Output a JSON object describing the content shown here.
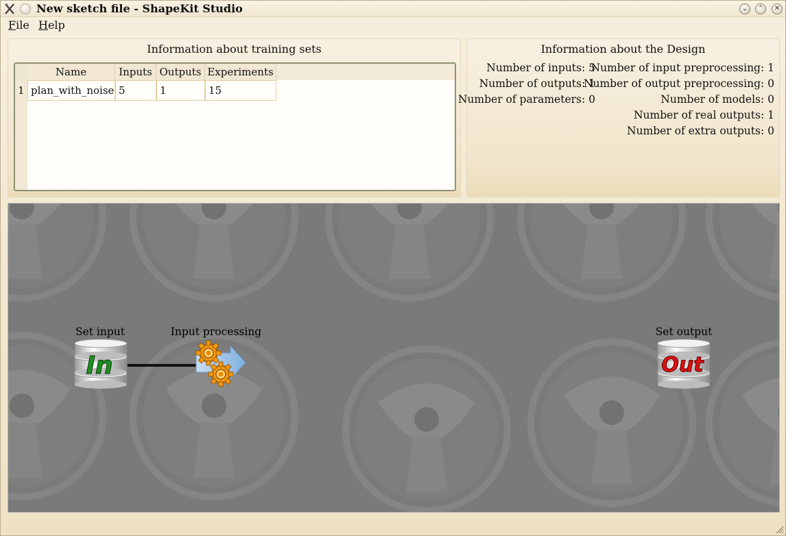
{
  "window": {
    "title": "New sketch file - ShapeKit Studio",
    "controls": {
      "minimize": "⌄",
      "maximize": "⌃",
      "close": "✕"
    }
  },
  "menu": {
    "file": {
      "accel": "F",
      "rest": "ile"
    },
    "help": {
      "accel": "H",
      "rest": "elp"
    }
  },
  "training_sets": {
    "title": "Information about training sets",
    "columns": [
      "Name",
      "Inputs",
      "Outputs",
      "Experiments"
    ],
    "rows": [
      {
        "index": "1",
        "name": "plan_with_noise",
        "inputs": "5",
        "outputs": "1",
        "experiments": "15"
      }
    ]
  },
  "design": {
    "title": "Information about the Design",
    "num_inputs": "Number of inputs: 5",
    "num_outputs": "Number of outputs: 1",
    "num_parameters": "Number of parameters: 0",
    "num_input_preprocessing": "Number of input preprocessing: 1",
    "num_output_preprocessing": "Number of output preprocessing: 0",
    "num_models": "Number of models: 0",
    "num_real_outputs": "Number of real outputs: 1",
    "num_extra_outputs": "Number of extra outputs: 0"
  },
  "canvas": {
    "nodes": {
      "set_input": {
        "label": "Set input",
        "icon_text": "In",
        "icon": "database-in-icon",
        "color": "#1a8a1a"
      },
      "input_processing": {
        "label": "Input processing",
        "icon": "gears-arrow-icon"
      },
      "set_output": {
        "label": "Set output",
        "icon_text": "Out",
        "icon": "database-out-icon",
        "color": "#e01010"
      }
    }
  }
}
